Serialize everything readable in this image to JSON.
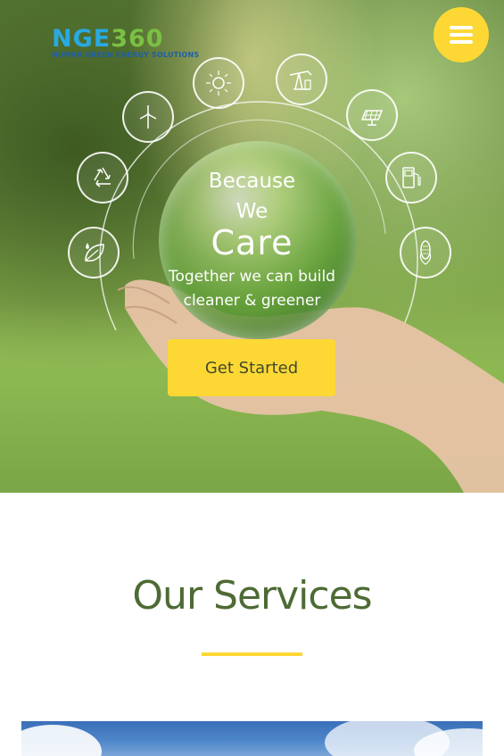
{
  "brand": {
    "logo_main": "NGE",
    "logo_accent": "360",
    "logo_subtitle": "NUMAR GREEN ENERGY SOLUTIONS"
  },
  "header": {
    "menu_icon": "hamburger-menu-icon"
  },
  "hero": {
    "line1": "Because",
    "line2": "We",
    "line3": "Care",
    "tagline1": "Together we can build",
    "tagline2": "cleaner & greener",
    "cta_label": "Get Started",
    "icons": [
      "leaf-drop-icon",
      "recycle-icon",
      "wind-turbine-icon",
      "sun-icon",
      "oil-pump-icon",
      "solar-panel-icon",
      "fuel-pump-icon",
      "corn-icon"
    ]
  },
  "services": {
    "title": "Our Services"
  },
  "colors": {
    "accent_yellow": "#fdd835",
    "title_green": "#4d6b34",
    "logo_blue": "#29a9e1",
    "logo_green": "#7bc043"
  }
}
